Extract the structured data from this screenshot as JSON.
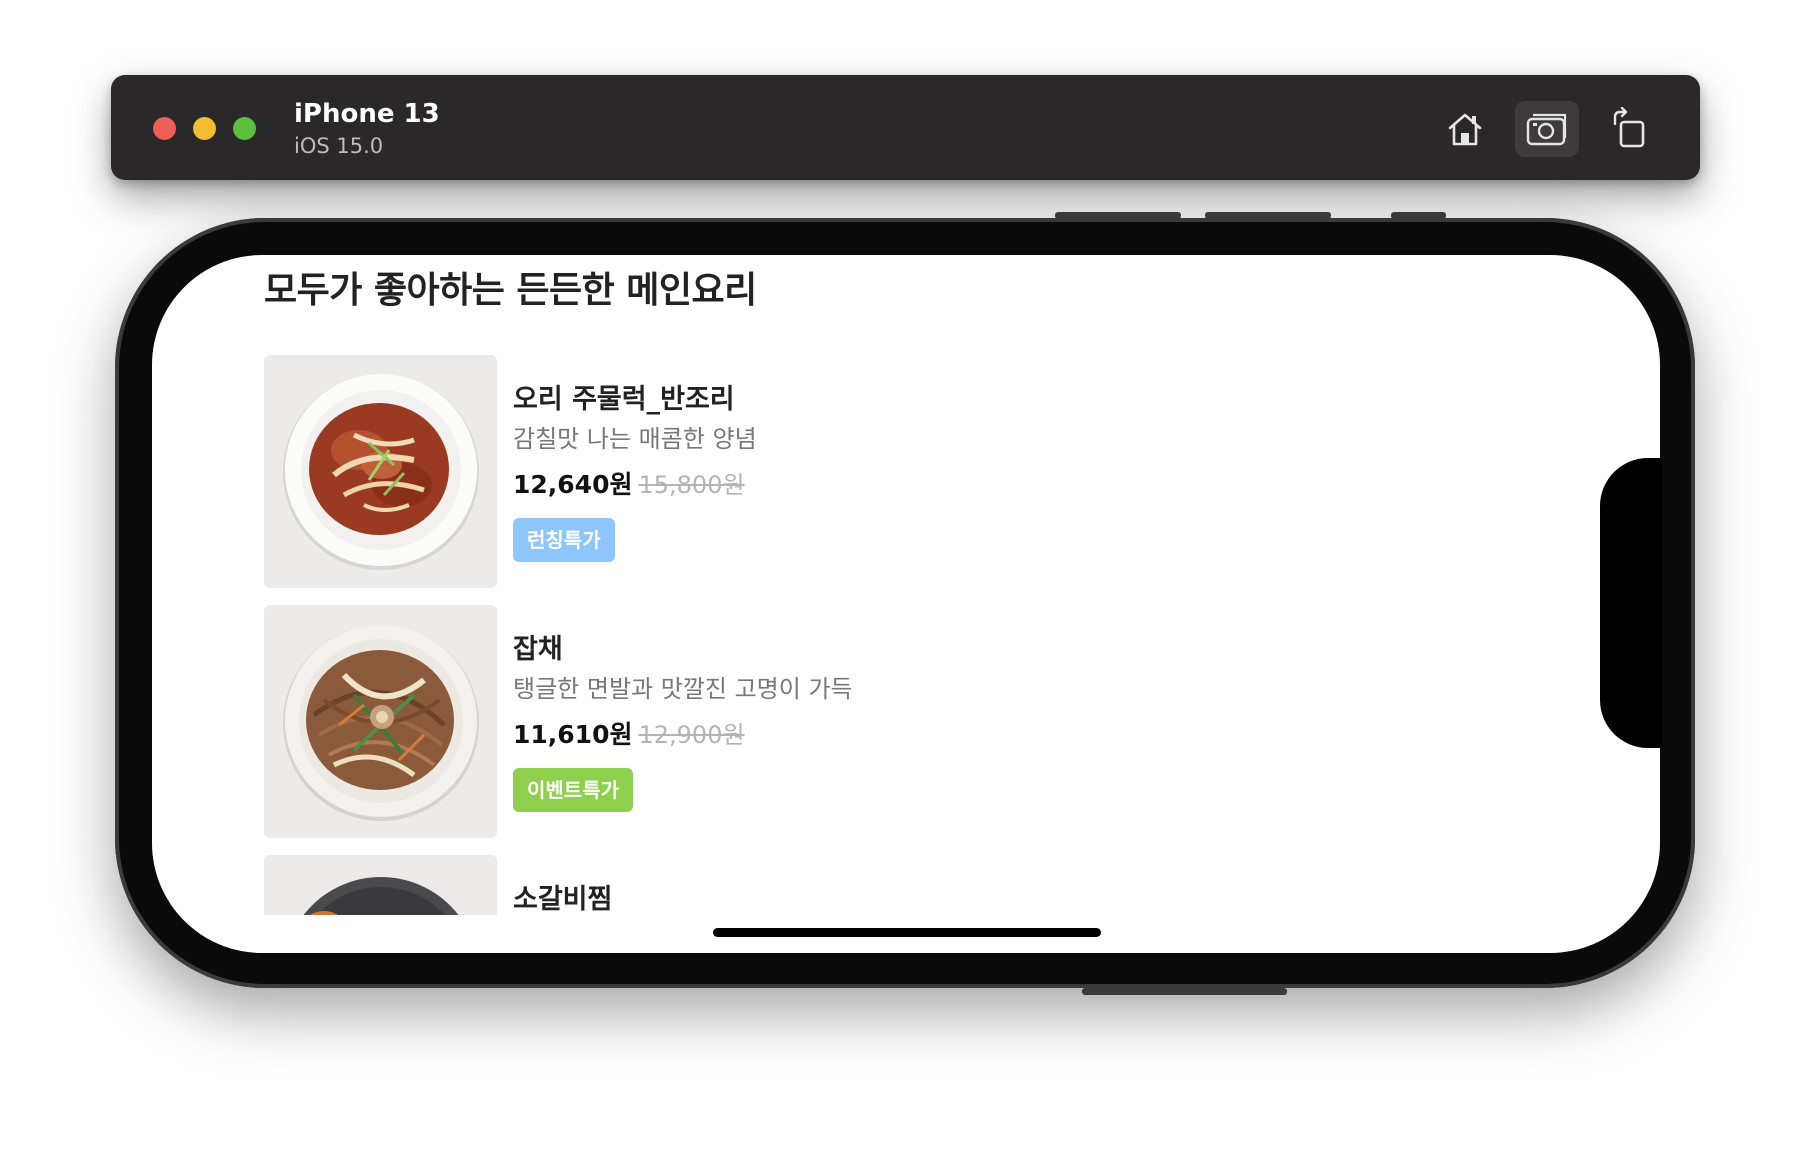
{
  "simulator": {
    "device_name": "iPhone 13",
    "os_version": "iOS 15.0",
    "buttons": {
      "home": "home-icon",
      "screenshot": "camera-icon",
      "rotate": "rotate-icon"
    }
  },
  "app": {
    "section_title": "모두가 좋아하는 든든한 메인요리",
    "items": [
      {
        "name": "오리 주물럭_반조리",
        "description": "감칠맛 나는 매콤한 양념",
        "price": "12,640원",
        "original_price": "15,800원",
        "tag": "런칭특가",
        "tag_color": "#8ec5fb"
      },
      {
        "name": "잡채",
        "description": "탱글한 면발과 맛깔진 고명이 가득",
        "price": "11,610원",
        "original_price": "12,900원",
        "tag": "이벤트특가",
        "tag_color": "#8fcf4e"
      },
      {
        "name": "소갈비찜"
      }
    ]
  }
}
